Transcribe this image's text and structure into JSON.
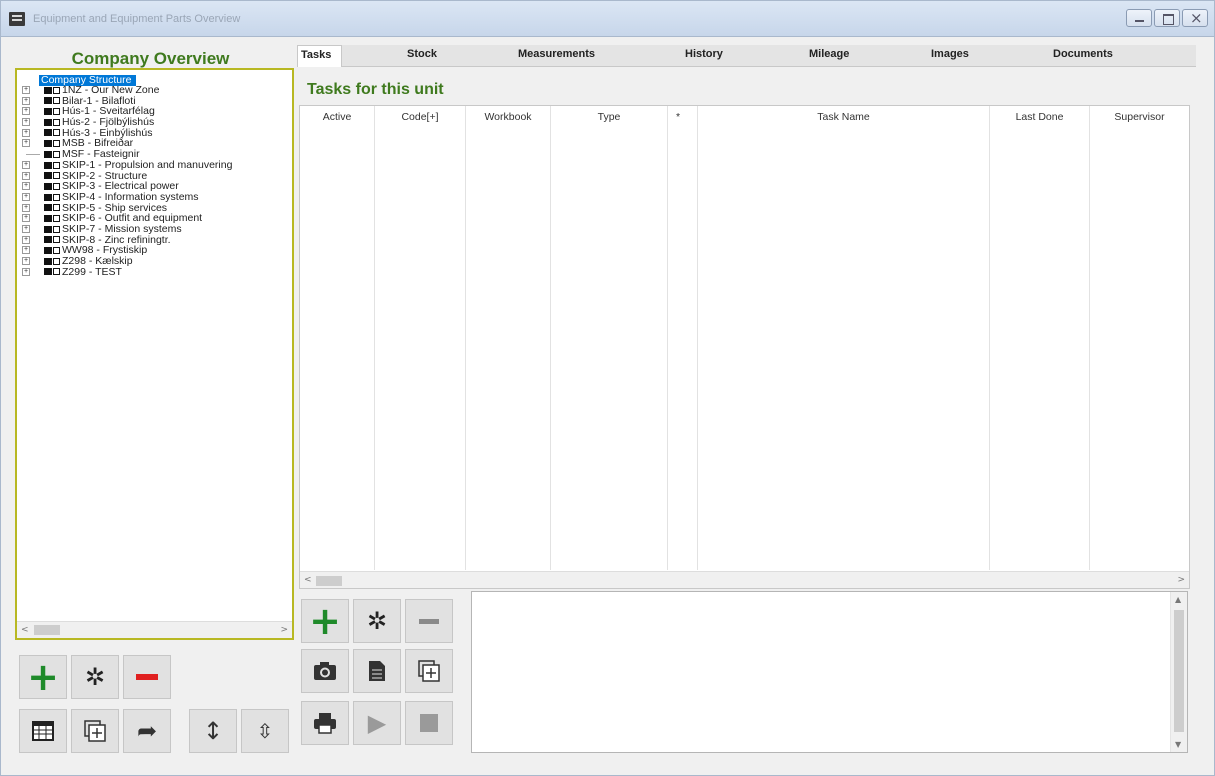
{
  "window": {
    "title": "Equipment and Equipment Parts Overview",
    "icon": "app-icon",
    "controls": [
      "minimize",
      "maximize",
      "close"
    ]
  },
  "left_panel": {
    "title": "Company Overview",
    "tree": {
      "root": "Company Structure",
      "items": [
        {
          "label": "1NZ - Our New Zone",
          "expandable": true
        },
        {
          "label": "Bilar-1 - Bilafloti",
          "expandable": true
        },
        {
          "label": "Hús-1 - Sveitarfélag",
          "expandable": true
        },
        {
          "label": "Hús-2 - Fjölbýlishús",
          "expandable": true
        },
        {
          "label": "Hús-3 - Einbýlishús",
          "expandable": true
        },
        {
          "label": "MSB - Bifreiðar",
          "expandable": true
        },
        {
          "label": "MSF - Fasteignir",
          "expandable": false
        },
        {
          "label": "SKIP-1 - Propulsion and manuvering",
          "expandable": true
        },
        {
          "label": "SKIP-2 - Structure",
          "expandable": true
        },
        {
          "label": "SKIP-3 - Electrical power",
          "expandable": true
        },
        {
          "label": "SKIP-4 - Information systems",
          "expandable": true
        },
        {
          "label": "SKIP-5 - Ship services",
          "expandable": true
        },
        {
          "label": "SKIP-6 - Outfit and equipment",
          "expandable": true
        },
        {
          "label": "SKIP-7 - Mission systems",
          "expandable": true
        },
        {
          "label": "SKIP-8 - Zinc refiningtr.",
          "expandable": true
        },
        {
          "label": "WW98 - Frystiskip",
          "expandable": true
        },
        {
          "label": "Z298 - Kælskip",
          "expandable": true
        },
        {
          "label": "Z299 - TEST",
          "expandable": true
        }
      ]
    },
    "buttons_row1": [
      "add-icon",
      "gear-icon",
      "remove-icon"
    ],
    "buttons_row2": [
      "table-icon",
      "copy-add-icon",
      "share-arrow-icon",
      "expand-vertical-icon",
      "collapse-vertical-icon"
    ]
  },
  "tabs": [
    {
      "label": "Tasks",
      "active": true
    },
    {
      "label": "Stock"
    },
    {
      "label": "Measurements"
    },
    {
      "label": "History"
    },
    {
      "label": "Mileage"
    },
    {
      "label": "Images"
    },
    {
      "label": "Documents"
    }
  ],
  "tasks": {
    "title": "Tasks for this unit",
    "columns": [
      "Active",
      "Code[+]",
      "Workbook",
      "Type",
      "*",
      "Task Name",
      "Last Done",
      "Supervisor"
    ],
    "rows": []
  },
  "task_buttons": {
    "row1": [
      "add-icon",
      "gear-icon",
      "remove-icon"
    ],
    "row2": [
      "camera-icon",
      "document-icon",
      "copy-add-icon"
    ],
    "row3": [
      "print-icon",
      "play-icon",
      "stop-icon"
    ]
  },
  "notes": {
    "text": ""
  },
  "colors": {
    "accent_green": "#3f7a1e",
    "tree_border": "#b8b823",
    "selection": "#0078d7",
    "add_green": "#1f8a2a",
    "remove_red": "#e02020"
  }
}
